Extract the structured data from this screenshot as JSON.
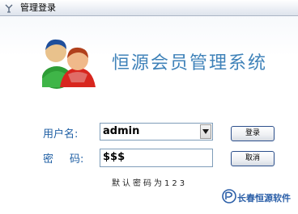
{
  "window": {
    "title": "管理登录"
  },
  "header": {
    "app_name": "恒源会员管理系统",
    "icon": "users-icon"
  },
  "form": {
    "username_label": "用户名:",
    "username_value": "admin",
    "password_label_first": "密",
    "password_label_second": "码:",
    "password_value": "$$$",
    "login_label": "登录",
    "cancel_label": "取消",
    "hint": "默认密码为123"
  },
  "footer": {
    "brand": "长春恒源软件"
  },
  "colors": {
    "brand_blue": "#3f82b9",
    "label_blue": "#1f5fa4"
  }
}
